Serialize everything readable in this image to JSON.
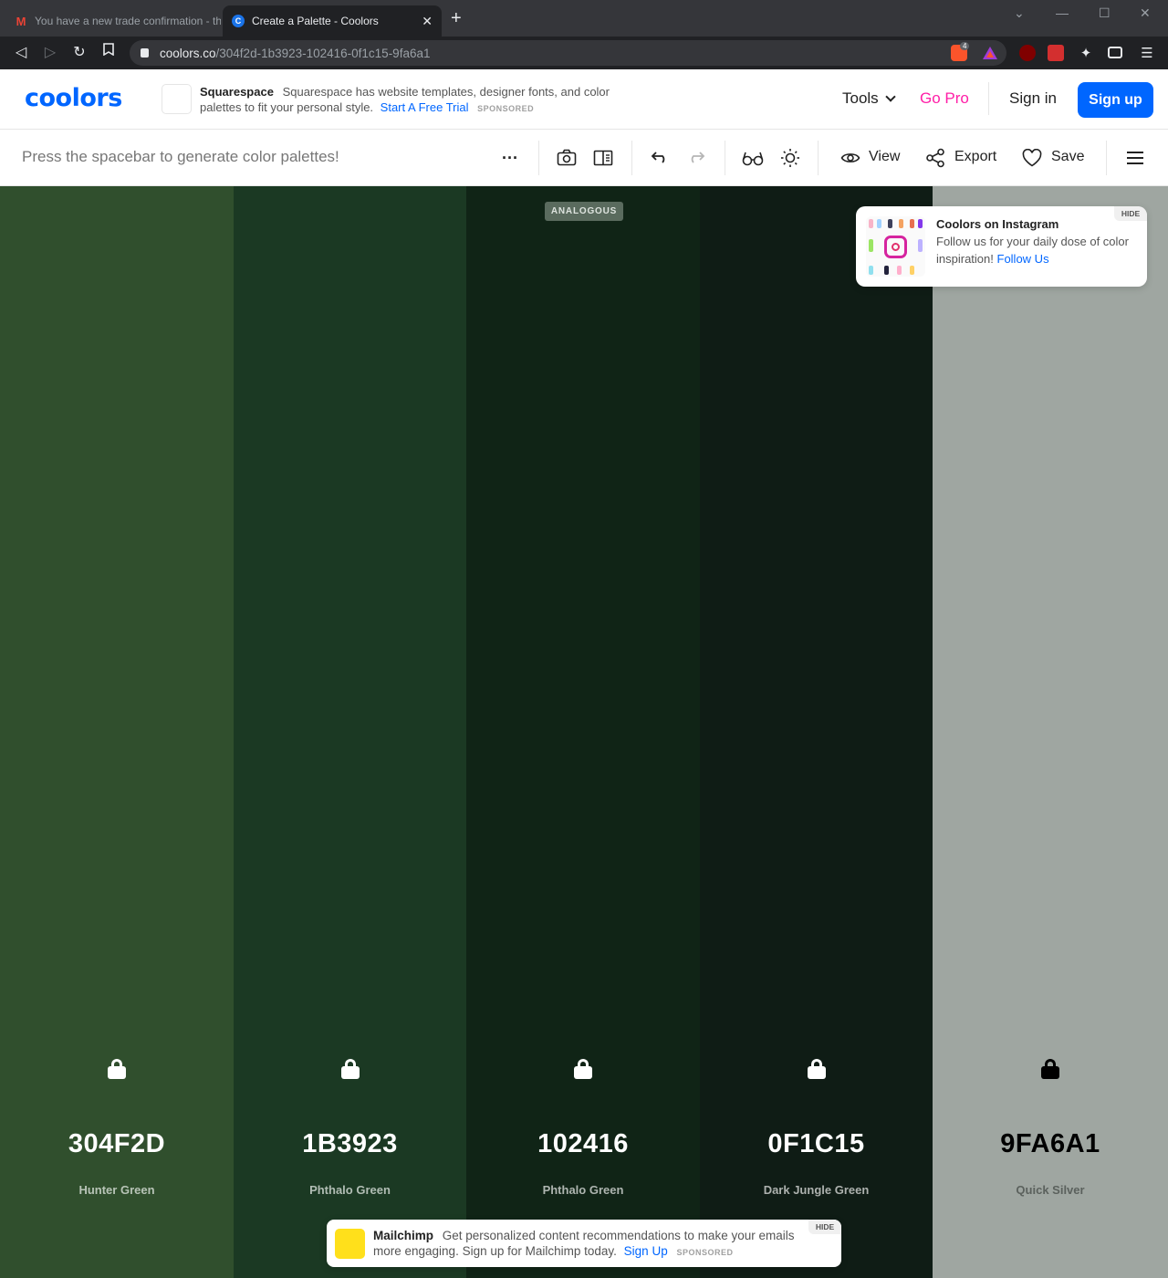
{
  "browser": {
    "tabs": [
      {
        "title": "You have a new trade confirmation - th",
        "active": false,
        "icon": "gmail-icon"
      },
      {
        "title": "Create a Palette - Coolors",
        "active": true,
        "icon": "coolors-favicon"
      }
    ],
    "url_host": "coolors.co",
    "url_path": "/304f2d-1b3923-102416-0f1c15-9fa6a1",
    "brave_badge_count": "4"
  },
  "header": {
    "logo": "coolors",
    "ad": {
      "brand": "Squarespace",
      "text": "Squarespace has website templates, designer fonts, and color palettes to fit your personal style.",
      "link": "Start A Free Trial",
      "sponsored": "SPONSORED"
    },
    "tools_label": "Tools",
    "gopro_label": "Go Pro",
    "signin_label": "Sign in",
    "signup_label": "Sign up"
  },
  "toolbar": {
    "hint": "Press the spacebar to generate color palettes!",
    "more_label": "···",
    "view_label": "View",
    "export_label": "Export",
    "save_label": "Save"
  },
  "palette": {
    "badge": "ANALOGOUS",
    "colors": [
      {
        "hex": "304F2D",
        "name": "Hunter Green",
        "bg": "#304f2d",
        "fg": "#ffffff",
        "name_color": "#b8c4b7"
      },
      {
        "hex": "1B3923",
        "name": "Phthalo Green",
        "bg": "#1b3923",
        "fg": "#ffffff",
        "name_color": "#b1bdb4"
      },
      {
        "hex": "102416",
        "name": "Phthalo Green",
        "bg": "#102416",
        "fg": "#ffffff",
        "name_color": "#aeb5b0"
      },
      {
        "hex": "0F1C15",
        "name": "Dark Jungle Green",
        "bg": "#0f1c15",
        "fg": "#ffffff",
        "name_color": "#adb1ae"
      },
      {
        "hex": "9FA6A1",
        "name": "Quick Silver",
        "bg": "#9fa6a1",
        "fg": "#000000",
        "name_color": "#5b615d"
      }
    ]
  },
  "instagram_card": {
    "title": "Coolors on Instagram",
    "text": "Follow us for your daily dose of color inspiration!",
    "link": "Follow Us",
    "hide": "HIDE"
  },
  "mailchimp_ad": {
    "brand": "Mailchimp",
    "text": "Get personalized content recommendations to make your emails more engaging. Sign up for Mailchimp today.",
    "link": "Sign Up",
    "sponsored": "SPONSORED",
    "hide": "HIDE"
  }
}
